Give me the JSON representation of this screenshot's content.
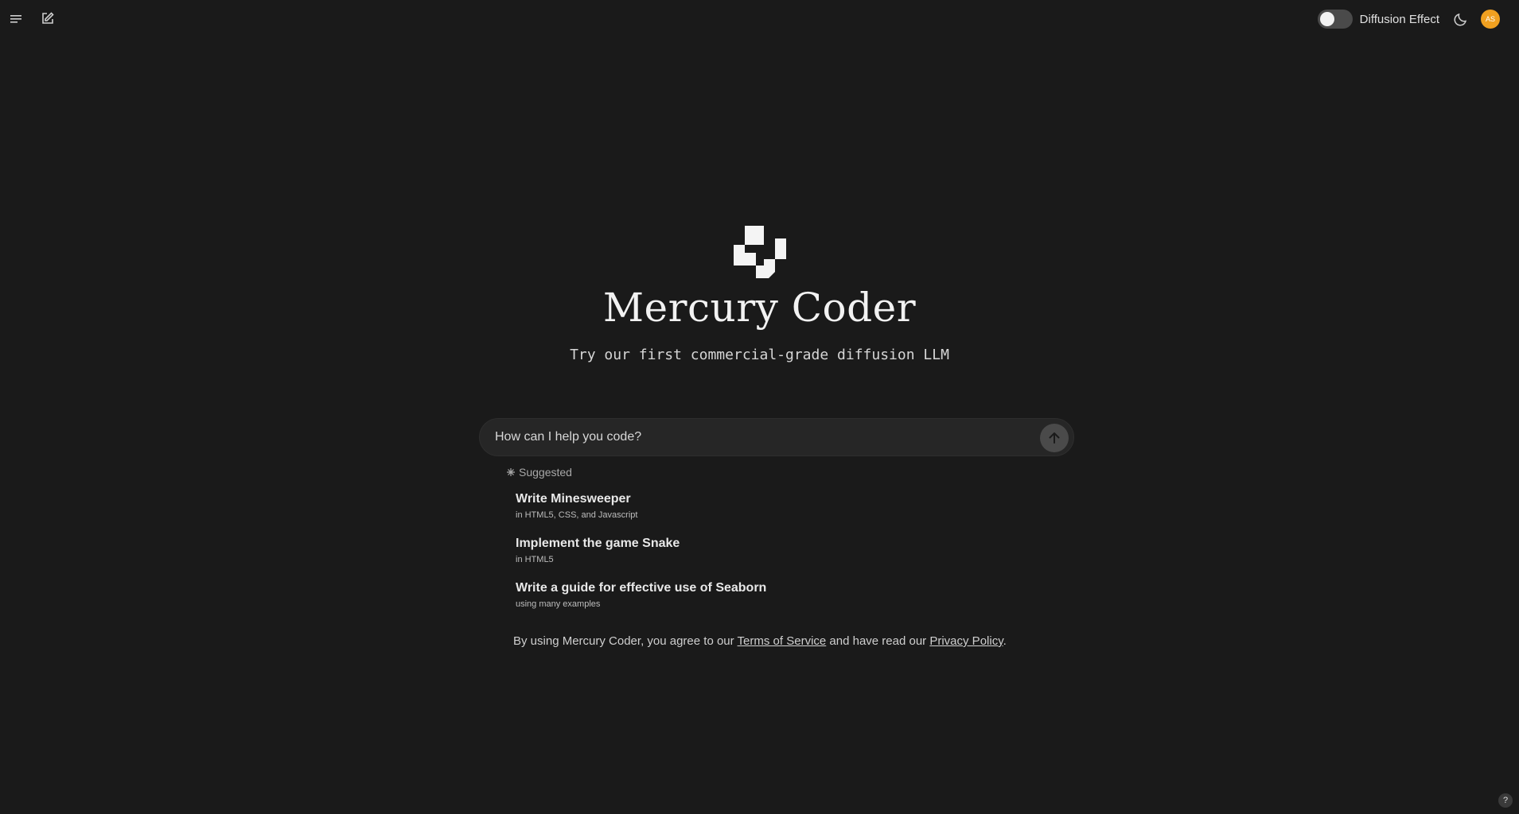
{
  "header": {
    "toggle_label": "Diffusion Effect",
    "toggle_on": false,
    "avatar_initials": "AS",
    "avatar_color": "#f0a020"
  },
  "hero": {
    "title": "Mercury Coder",
    "subtitle": "Try our first commercial-grade diffusion LLM"
  },
  "search": {
    "placeholder": "How can I help you code?",
    "value": ""
  },
  "suggestions": {
    "heading": "Suggested",
    "items": [
      {
        "title": "Write Minesweeper",
        "subtitle": "in HTML5, CSS, and Javascript"
      },
      {
        "title": "Implement the game Snake",
        "subtitle": "in HTML5"
      },
      {
        "title": "Write a guide for effective use of Seaborn",
        "subtitle": "using many examples"
      }
    ]
  },
  "footer": {
    "prefix": "By using Mercury Coder, you agree to our ",
    "terms_link": "Terms of Service",
    "middle": " and have read our ",
    "privacy_link": "Privacy Policy",
    "suffix": "."
  },
  "help": {
    "label": "?"
  },
  "icons": {
    "menu": "menu-icon",
    "new_chat": "edit-icon",
    "theme": "moon-icon",
    "send": "arrow-up-icon",
    "sparkle": "sparkle-icon"
  }
}
